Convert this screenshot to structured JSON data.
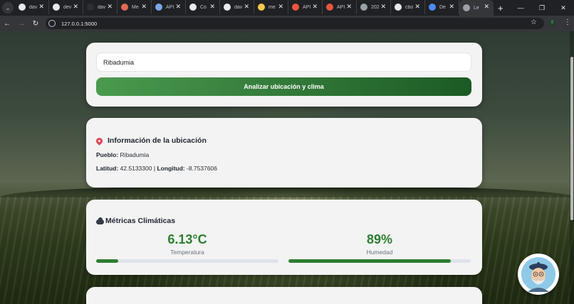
{
  "browser": {
    "tabs": [
      {
        "label": "dav",
        "icon": "github-icon",
        "color": "#e8eaed"
      },
      {
        "label": "dev",
        "icon": "github-icon",
        "color": "#e8eaed"
      },
      {
        "label": "dav",
        "icon": "circle-icon",
        "color": "#2d2f33"
      },
      {
        "label": "Me",
        "icon": "site-icon",
        "color": "#e26a55"
      },
      {
        "label": "API",
        "icon": "site-icon",
        "color": "#7aa7e8"
      },
      {
        "label": "Co",
        "icon": "github-icon",
        "color": "#e8eaed"
      },
      {
        "label": "dav",
        "icon": "github-icon",
        "color": "#e8eaed"
      },
      {
        "label": "me",
        "icon": "site-icon",
        "color": "#f5c84b"
      },
      {
        "label": "API",
        "icon": "site-icon",
        "color": "#e8553e"
      },
      {
        "label": "API",
        "icon": "site-icon",
        "color": "#e8553e"
      },
      {
        "label": "202",
        "icon": "globe-icon",
        "color": "#9aa0a6"
      },
      {
        "label": "cbo",
        "icon": "github-icon",
        "color": "#e8eaed"
      },
      {
        "label": "De",
        "icon": "site-icon",
        "color": "#4c8bf5"
      },
      {
        "label": "Le",
        "icon": "globe-icon",
        "color": "#9aa0a6",
        "active": true
      }
    ],
    "url": "127.0.0.1:5000",
    "extension_badge": "0"
  },
  "search": {
    "value": "Ribadumia",
    "button_label": "Analizar ubicación y clima"
  },
  "location": {
    "title": "Información de la ubicación",
    "town_label": "Pueblo:",
    "town": "Ribadumia",
    "lat_label": "Latitud:",
    "lat": "42.5133300",
    "separator": "|",
    "lon_label": "Longitud:",
    "lon": "-8.7537606"
  },
  "climate": {
    "title": "Métricas Climáticas",
    "temperature": {
      "value": "6.13°C",
      "label": "Temperatura",
      "bar_fraction": 0.12
    },
    "humidity": {
      "value": "89%",
      "label": "Humedad",
      "bar_fraction": 0.89
    }
  },
  "colors": {
    "accent_green": "#2f7d32",
    "button_gradient_start": "#4a9a4e",
    "button_gradient_end": "#1c5a25"
  }
}
